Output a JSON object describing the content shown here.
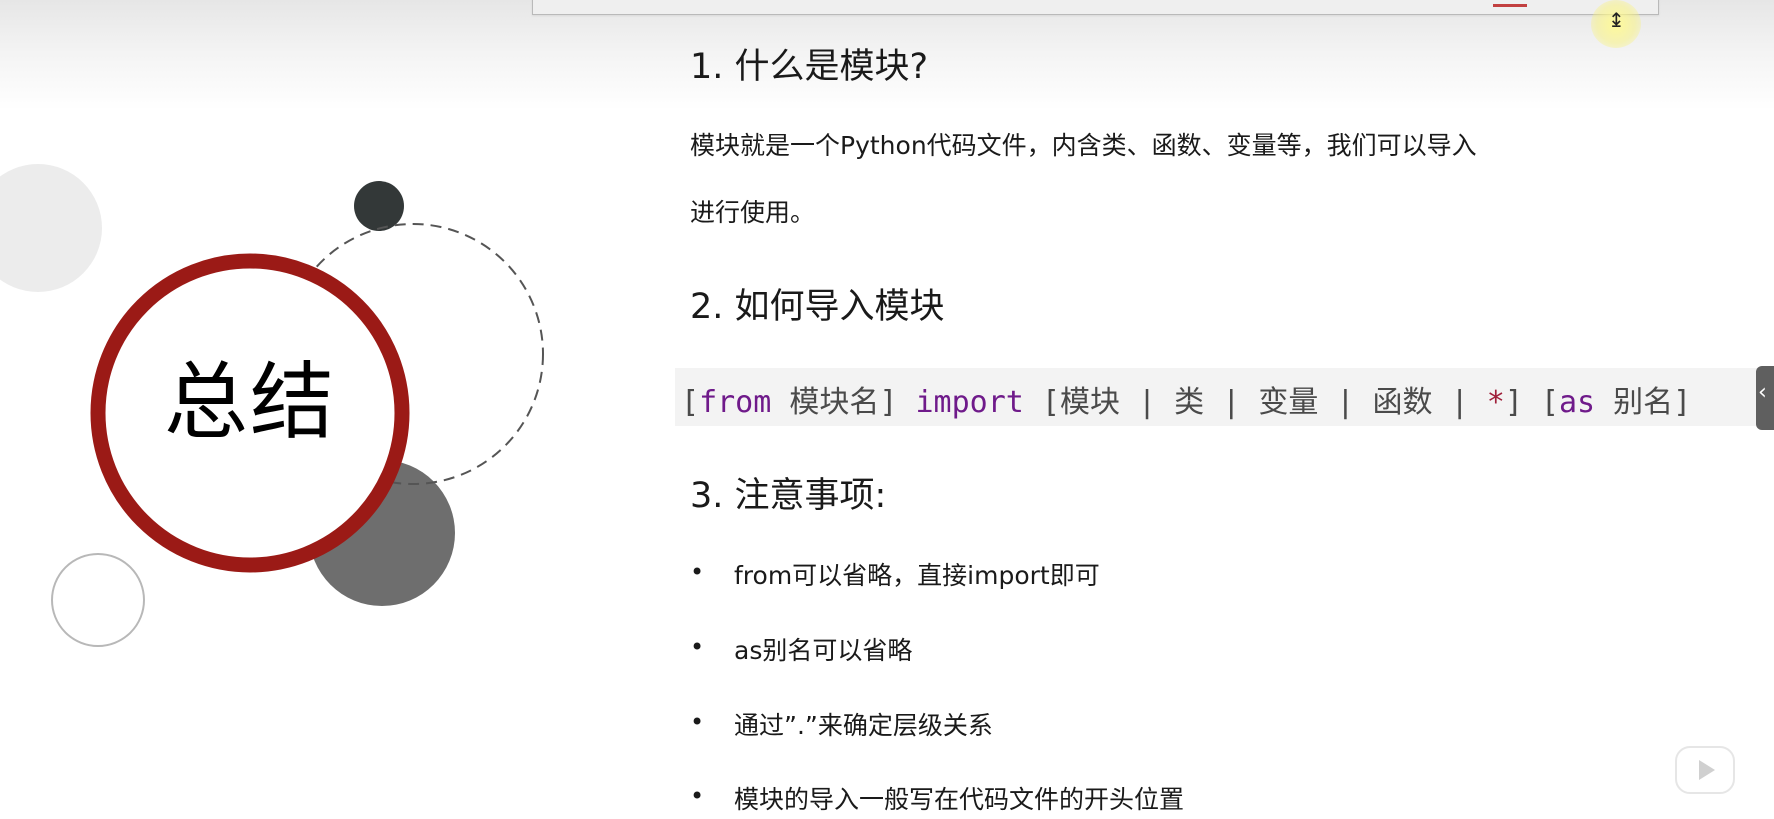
{
  "summary": {
    "title": "总结"
  },
  "sections": {
    "s1": {
      "heading": "1. 什么是模块?",
      "body_line1": "模块就是一个Python代码文件，内含类、函数、变量等，我们可以导入",
      "body_line2": "进行使用。"
    },
    "s2": {
      "heading": "2. 如何导入模块"
    },
    "s3": {
      "heading": "3. 注意事项:"
    }
  },
  "code": {
    "open1": "[",
    "from": "from",
    "module_name": " 模块名] ",
    "import": "import",
    "options_open": " [模块 | 类 | 变量 | 函数 | ",
    "star": "*",
    "options_close": "] [",
    "as": "as",
    "alias": " 别名]"
  },
  "notes": [
    {
      "bullet": "•",
      "text": "from可以省略，直接import即可"
    },
    {
      "bullet": "•",
      "text": "as别名可以省略"
    },
    {
      "bullet": "•",
      "text": "通过”.”来确定层级关系"
    },
    {
      "bullet": "•",
      "text": "模块的导入一般写在代码文件的开头位置"
    }
  ],
  "cursor": {
    "glyph": "↨"
  },
  "side_tab": {
    "glyph": "‹"
  },
  "colors": {
    "ring_red": "#9b1a16",
    "dark_dot": "#333838",
    "gray_circle": "#6e6e6e",
    "keyword_purple": "#6f1a8a",
    "star_red": "#a0203a"
  },
  "icons": {
    "video_play": "play-icon"
  }
}
